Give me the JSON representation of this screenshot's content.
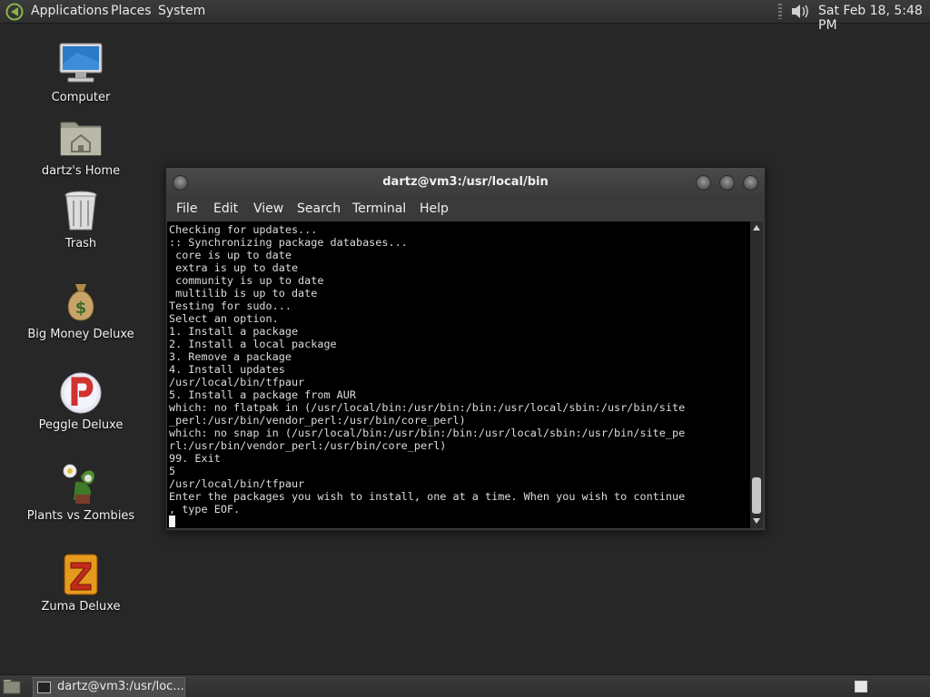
{
  "top_panel": {
    "menus": [
      "Applications",
      "Places",
      "System"
    ],
    "clock": "Sat Feb 18,  5:48 PM"
  },
  "desktop_icons": [
    {
      "label": "Computer",
      "icon": "computer-icon"
    },
    {
      "label": "dartz's Home",
      "icon": "home-folder-icon"
    },
    {
      "label": "Trash",
      "icon": "trash-icon"
    },
    {
      "label": "Big Money Deluxe",
      "icon": "money-bag-icon"
    },
    {
      "label": "Peggle Deluxe",
      "icon": "peggle-icon"
    },
    {
      "label": "Plants vs Zombies",
      "icon": "plants-vs-zombies-icon"
    },
    {
      "label": "Zuma Deluxe",
      "icon": "zuma-icon"
    }
  ],
  "terminal": {
    "title": "dartz@vm3:/usr/local/bin",
    "menu": [
      "File",
      "Edit",
      "View",
      "Search",
      "Terminal",
      "Help"
    ],
    "lines": [
      "Checking for updates...",
      ":: Synchronizing package databases...",
      " core is up to date",
      " extra is up to date",
      " community is up to date",
      " multilib is up to date",
      "Testing for sudo...",
      "Select an option.",
      "1. Install a package",
      "2. Install a local package",
      "3. Remove a package",
      "4. Install updates",
      "/usr/local/bin/tfpaur",
      "5. Install a package from AUR",
      "which: no flatpak in (/usr/local/bin:/usr/bin:/bin:/usr/local/sbin:/usr/bin/site",
      "_perl:/usr/bin/vendor_perl:/usr/bin/core_perl)",
      "which: no snap in (/usr/local/bin:/usr/bin:/bin:/usr/local/sbin:/usr/bin/site_pe",
      "rl:/usr/bin/vendor_perl:/usr/bin/core_perl)",
      "99. Exit",
      "5",
      "/usr/local/bin/tfpaur",
      "Enter the packages you wish to install, one at a time. When you wish to continue",
      ", type EOF."
    ]
  },
  "bottom_panel": {
    "task_label": "dartz@vm3:/usr/loc..."
  },
  "colors": {
    "desktop_bg": "#262726",
    "panel_bg": "#333433",
    "terminal_bg": "#000000",
    "terminal_fg": "#dcdcdc"
  }
}
